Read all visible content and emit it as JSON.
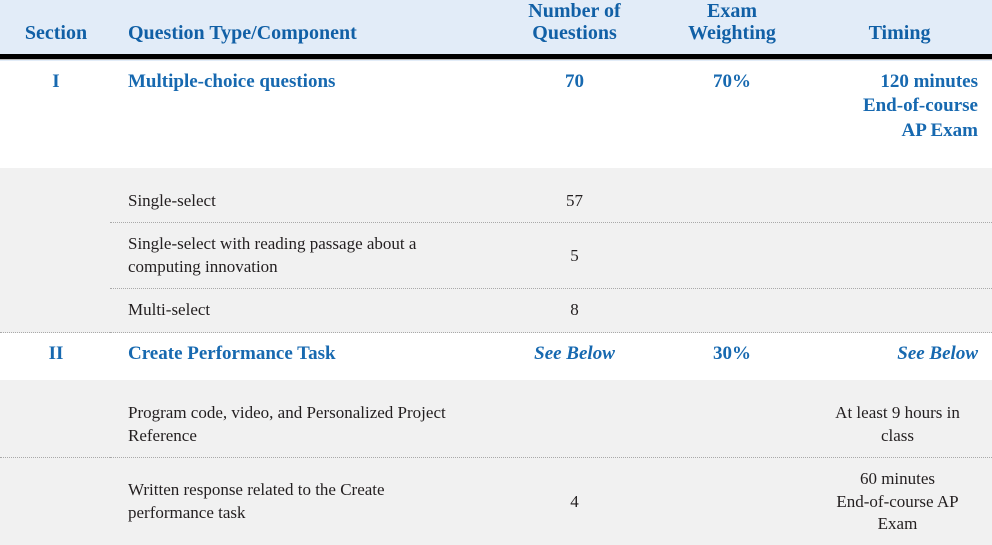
{
  "table": {
    "columns": [
      {
        "key": "section",
        "label": "Section"
      },
      {
        "key": "type",
        "label": "Question Type/Component"
      },
      {
        "key": "num",
        "label": "Number of\nQuestions",
        "line1": "Number of",
        "line2": "Questions"
      },
      {
        "key": "weight",
        "label": "Exam\nWeighting",
        "line1": "Exam",
        "line2": "Weighting"
      },
      {
        "key": "timing",
        "label": "Timing",
        "line1": "Timing",
        "line2": ""
      }
    ],
    "rows": [
      {
        "kind": "section",
        "section": "I",
        "type": "Multiple-choice questions",
        "num": "70",
        "weight": "70%",
        "timing_line1": "120 minutes",
        "timing_line2": "End-of-course",
        "timing_line3": "AP Exam"
      },
      {
        "kind": "sub",
        "section": "",
        "type": "Single-select",
        "num": "57",
        "weight": "",
        "timing": ""
      },
      {
        "kind": "sub",
        "section": "",
        "type": "Single-select with reading passage about a computing innovation",
        "num": "5",
        "weight": "",
        "timing": ""
      },
      {
        "kind": "sub",
        "section": "",
        "type": "Multi-select",
        "num": "8",
        "weight": "",
        "timing": ""
      },
      {
        "kind": "section",
        "section": "II",
        "type": "Create Performance Task",
        "num": "See Below",
        "weight": "30%",
        "timing_line1": "See Below",
        "timing_line2": "",
        "timing_line3": ""
      },
      {
        "kind": "sub",
        "section": "",
        "type": "Program code, video, and Personalized Project Reference",
        "num": "",
        "weight": "",
        "timing": "At least 9 hours in class"
      },
      {
        "kind": "sub",
        "section": "",
        "type": "Written response related to the Create performance task",
        "num": "4",
        "weight": "",
        "timing_line1": "60 minutes",
        "timing_line2": "End-of-course AP",
        "timing_line3": "Exam"
      }
    ]
  },
  "colors": {
    "header_bg": "#e2ecf8",
    "header_text": "#1160a6",
    "section_text": "#1769b0",
    "sub_bg": "#f1f1f1",
    "sub_text": "#231f20",
    "rule": "#000000",
    "dotted": "#a9a9a9"
  }
}
